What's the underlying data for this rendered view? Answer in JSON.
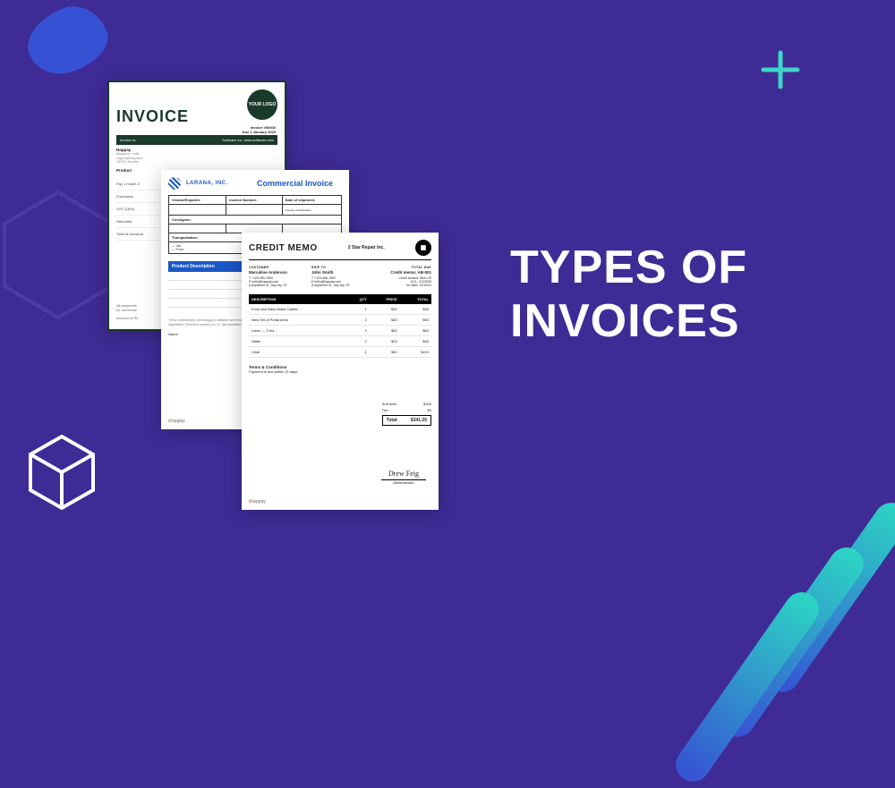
{
  "headline_l1": "TYPES OF",
  "headline_l2": "INVOICES",
  "brand": "happay",
  "doc1": {
    "logo_text": "YOUR LOGO",
    "title": "INVOICE",
    "meta1": "Invoice #00000",
    "meta2": "Due 1 January 2025",
    "band_l": "Invoice to:",
    "band_r": "Software Inc. www.software.com",
    "client": "Happay",
    "phead": "Product",
    "r1": "Pay 1 month  X",
    "r2": "Purchases",
    "r3": "GST (18%)",
    "r4": "Refunded",
    "r5": "Total at checkout",
    "foot1": "All payments",
    "foot2": "for reference",
    "foot3": "Amount of Rs"
  },
  "doc2": {
    "company": "LARANA, INC.",
    "title": "Commercial Invoice",
    "h1": "Vendor/Exporter:",
    "h2": "Invoice Number:",
    "h3": "Date of shipment:",
    "h4": "Consignee:",
    "h5": "Transportation:",
    "t1": "— Via:",
    "t2": "— From:",
    "pd": "Product Description",
    "disc": "These commodities, technology or software were exported from the United States in accordance with export administration regulations. Diversion contrary to U.S. law prohibited. We certify that this commercial invoice is true and correct.",
    "name": "Name:"
  },
  "doc3": {
    "title": "CREDIT MEMO",
    "company": "2 Star Repair Inc.",
    "c1_lbl": "CUSTOMER",
    "c1_name": "Marceline Anderson",
    "c2_lbl": "SHIP TO",
    "c2_name": "John Smith",
    "c3_lbl": "TOTAL DUE",
    "c3_name": "Credit memo: AB-001",
    "phone1": "T +123-456-7890",
    "phone2": "T +123-456-7890",
    "email1": "E hello@happay.com",
    "email2": "E hello@happay.com",
    "addr1": "A anywhere st., any city, ST",
    "addr2": "A anywhere st., any city, ST",
    "inv_meta1": "Credit amount: $541.25",
    "inv_meta2": "M.D.: 2/1/2025",
    "inv_meta3": "Inv date: 10/10/24",
    "th_desc": "DESCRIPTION",
    "th_qty": "QTY",
    "th_price": "PRICE",
    "th_total": "TOTAL",
    "rows": [
      {
        "d": "Front and Back Brake Cables",
        "q": "1",
        "p": "$30",
        "t": "$30"
      },
      {
        "d": "New Set of Pedal Arms",
        "q": "2",
        "p": "$45",
        "t": "$90"
      },
      {
        "d": "Labor — 3 hrs",
        "q": "3",
        "p": "$50",
        "t": "$60"
      },
      {
        "d": "Water",
        "q": "2",
        "p": "$20",
        "t": "$40"
      },
      {
        "d": "Chair",
        "q": "1",
        "p": "$50",
        "t": "$100"
      }
    ],
    "terms_t": "Terms & Conditions",
    "terms_b": "Payment is due within 15 days.",
    "sub_l": "Sub total:",
    "sub_v": "$320",
    "tax_l": "Tax:",
    "tax_v": "$0",
    "tot_l": "Total:",
    "tot_v": "$341.25",
    "sig_name": "Drew Feig",
    "sig_role": "Administrator"
  }
}
